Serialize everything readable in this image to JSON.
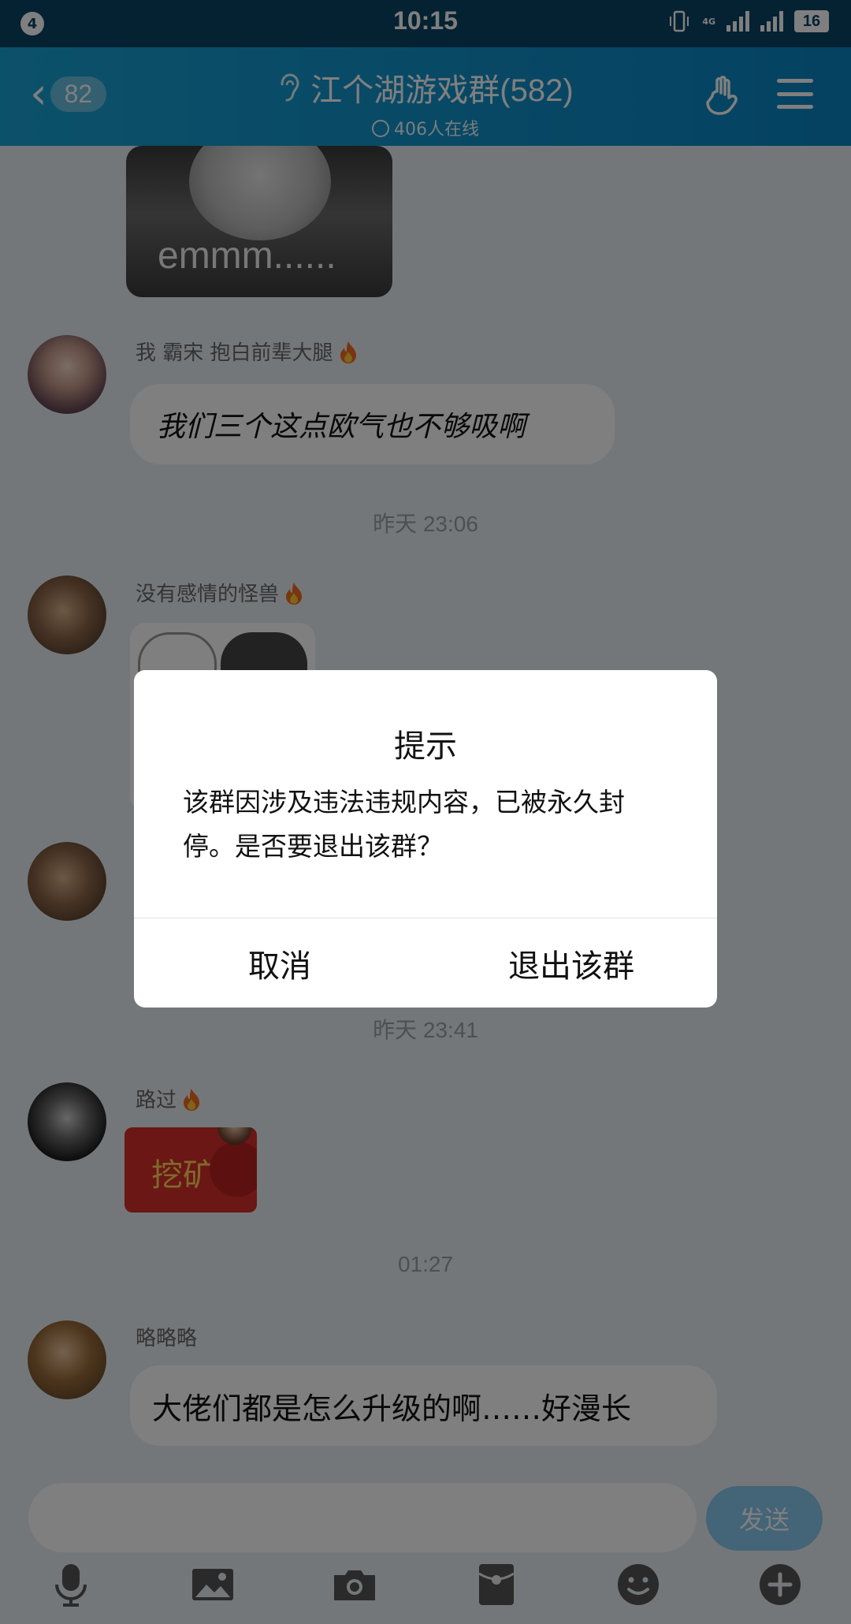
{
  "status_bar": {
    "notification_count": "4",
    "time": "10:15",
    "network_label": "4G",
    "battery_level": "16"
  },
  "header": {
    "unread_count": "82",
    "title": "江个湖游戏群(582)",
    "subtitle": "406人在线",
    "icons": [
      "back-icon",
      "ear-icon",
      "hand-icon",
      "menu-icon"
    ]
  },
  "messages": [
    {
      "type": "image",
      "caption": "emmm......"
    },
    {
      "type": "text",
      "sender": "我  霸宋   抱白前辈大腿",
      "text": "我们三个这点欧气也不够吸啊"
    },
    {
      "type": "timestamp",
      "text": "昨天 23:06"
    },
    {
      "type": "image",
      "sender": "没有感情的怪兽"
    },
    {
      "type": "timestamp",
      "text": "昨天 23:41"
    },
    {
      "type": "red_packet",
      "sender": "路过",
      "text": "挖矿"
    },
    {
      "type": "timestamp",
      "text": "01:27"
    },
    {
      "type": "text",
      "sender": "略略略",
      "text": "大佬们都是怎么升级的啊……好漫长"
    }
  ],
  "composer": {
    "input_value": "",
    "send_label": "发送",
    "tools": [
      "microphone-icon",
      "image-icon",
      "camera-icon",
      "red-packet-icon",
      "emoji-icon",
      "plus-icon"
    ]
  },
  "dialog": {
    "title": "提示",
    "message": "该群因涉及违法违规内容，已被永久封停。是否要退出该群？",
    "cancel_label": "取消",
    "confirm_label": "退出该群"
  },
  "colors": {
    "header_start": "#18a2d4",
    "header_end": "#0a84c4",
    "status_bar": "#0a4567",
    "send_button": "#89c9ef",
    "red_packet": "#d42e2a"
  }
}
